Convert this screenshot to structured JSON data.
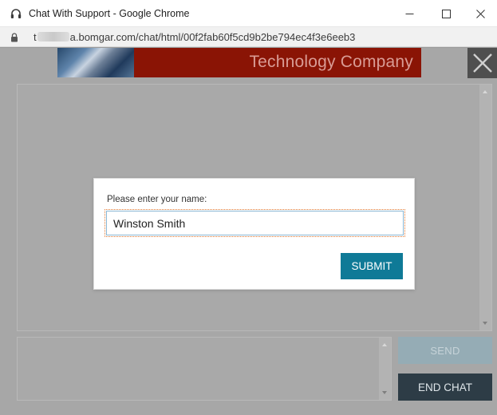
{
  "window": {
    "title": "Chat With Support - Google Chrome",
    "url_prefix": "t",
    "url_rest": "a.bomgar.com/chat/html/00f2fab60f5cd9b2be794ec4f3e6eeb3"
  },
  "banner": {
    "company_name": "Technology Company"
  },
  "dialog": {
    "prompt": "Please enter your name:",
    "name_value": "Winston Smith",
    "submit_label": "SUBMIT"
  },
  "controls": {
    "send_label": "SEND",
    "end_chat_label": "END CHAT"
  },
  "colors": {
    "banner_red": "#8a1405",
    "submit_teal": "#0f7a97",
    "end_chat_dark": "#2d3c46",
    "overlay_gray": "#a7a7a7"
  },
  "icons": {
    "app": "headset-icon",
    "lock": "lock-icon",
    "minimize": "minimize-icon",
    "maximize": "maximize-icon",
    "close": "close-icon",
    "chat_close": "close-x-icon"
  }
}
